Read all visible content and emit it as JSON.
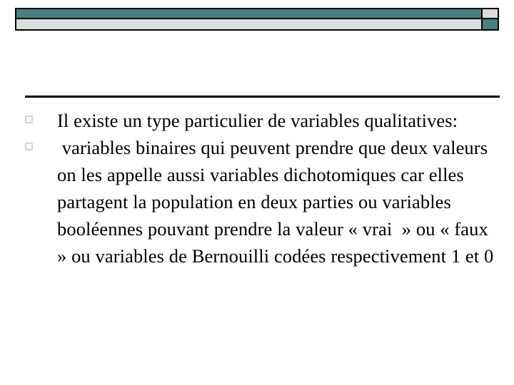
{
  "slide": {
    "decor": {
      "bar_top_color": "#46807f",
      "bar_bottom_color": "#dcdcdc",
      "bar_border_color": "#000000",
      "accent_square_color": "#46807f",
      "rule_color": "#000000",
      "bullet_marker_color": "#d4d4d4",
      "bullet_marker_glyph": "hollow-square"
    },
    "title": "",
    "bullets": [
      {
        "marker": "square-bullet",
        "text": "Il existe un type particulier de variables qualitatives:"
      },
      {
        "marker": "square-bullet",
        "text": " variables binaires qui peuvent prendre que deux valeurs on les appelle aussi variables dichotomiques car elles partagent la population en deux parties ou variables booléennes pouvant prendre la valeur « vrai  » ou « faux » ou variables de Bernouilli codées respectivement 1 et 0"
      }
    ]
  }
}
